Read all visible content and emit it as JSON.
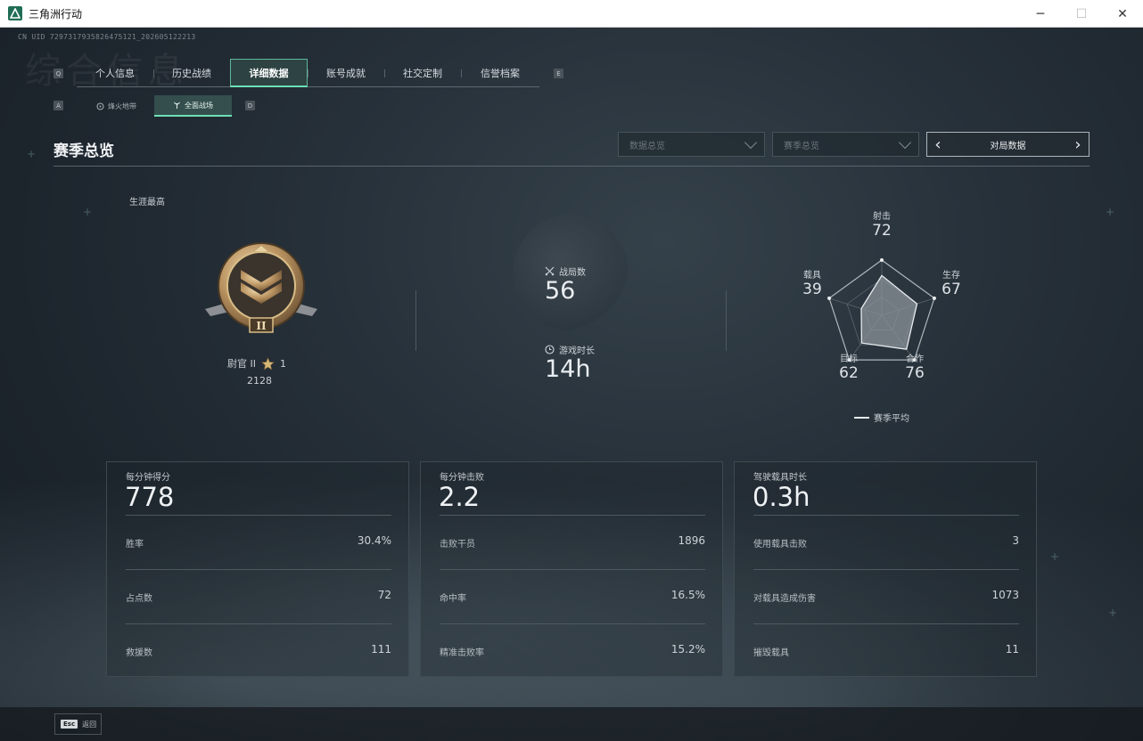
{
  "window": {
    "title": "三角洲行动",
    "minimize": "─",
    "maximize": "☐",
    "close": "✕"
  },
  "uid": "CN UID 7297317935826475121_202605122213",
  "bg_text": "综合信息",
  "main_tabs": {
    "left_key": "Q",
    "right_key": "E",
    "items": [
      {
        "label": "个人信息",
        "active": false
      },
      {
        "label": "历史战绩",
        "active": false
      },
      {
        "label": "详细数据",
        "active": true
      },
      {
        "label": "账号成就",
        "active": false
      },
      {
        "label": "社交定制",
        "active": false
      },
      {
        "label": "信誉档案",
        "active": false
      }
    ]
  },
  "sub_tabs": {
    "left_key": "A",
    "right_key": "D",
    "items": [
      {
        "label": "烽火地带",
        "icon": "target-icon",
        "active": false
      },
      {
        "label": "全面战场",
        "icon": "antenna-icon",
        "active": true
      }
    ]
  },
  "header": {
    "title": "赛季总览",
    "dropdown1": "数据总览",
    "dropdown2": "赛季总览",
    "pager_label": "对局数据",
    "pager_prev": "‹",
    "pager_next": "›"
  },
  "rank": {
    "career_label": "生涯最高",
    "rank_name": "尉官 II",
    "stars": "1",
    "points": "2128",
    "badge_numeral": "II"
  },
  "mid_stats": {
    "matches_label": "战局数",
    "matches_value": "56",
    "playtime_label": "游戏时长",
    "playtime_value": "14h"
  },
  "radar": {
    "axes": [
      {
        "label": "射击",
        "value": 72
      },
      {
        "label": "生存",
        "value": 67
      },
      {
        "label": "合作",
        "value": 76
      },
      {
        "label": "目标",
        "value": 62
      },
      {
        "label": "载具",
        "value": 39
      }
    ],
    "legend": "赛季平均",
    "fill_color": "#8b9399"
  },
  "cards": [
    {
      "title": "每分钟得分",
      "value": "778",
      "rows": [
        {
          "k": "胜率",
          "v": "30.4%"
        },
        {
          "k": "占点数",
          "v": "72"
        },
        {
          "k": "救援数",
          "v": "111"
        }
      ]
    },
    {
      "title": "每分钟击败",
      "value": "2.2",
      "rows": [
        {
          "k": "击败干员",
          "v": "1896"
        },
        {
          "k": "命中率",
          "v": "16.5%"
        },
        {
          "k": "精准击败率",
          "v": "15.2%"
        }
      ]
    },
    {
      "title": "驾驶载具时长",
      "value": "0.3h",
      "rows": [
        {
          "k": "使用载具击败",
          "v": "3"
        },
        {
          "k": "对载具造成伤害",
          "v": "1073"
        },
        {
          "k": "摧毁载具",
          "v": "11"
        }
      ]
    }
  ],
  "bottom": {
    "esc_key": "Esc",
    "esc_label": "返回"
  },
  "colors": {
    "accent": "#6fe0b5",
    "text": "#d8dde2",
    "gold": "#c9a467"
  }
}
